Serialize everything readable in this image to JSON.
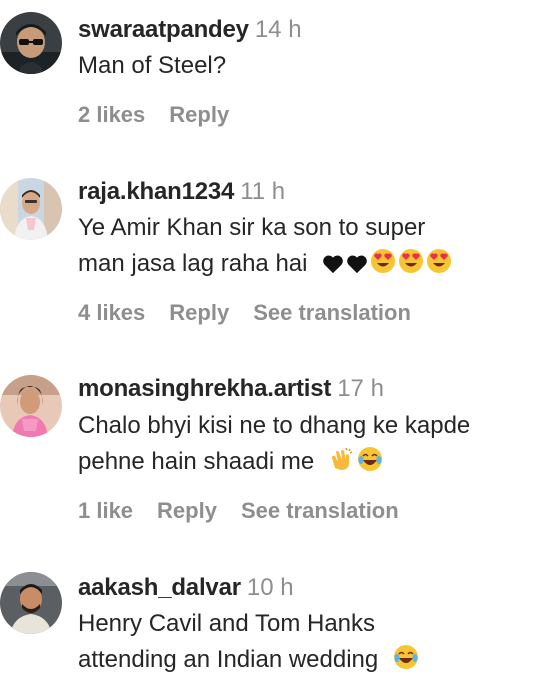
{
  "comments": [
    {
      "username": "swaraatpandey",
      "time": "14 h",
      "lines": [
        "Man of Steel?"
      ],
      "likes": "2 likes",
      "reply": "Reply",
      "translation": ""
    },
    {
      "username": "raja.khan1234",
      "time": "11 h",
      "lines": [
        "Ye Amir Khan sir ka son to super",
        "man jasa lag raha hai"
      ],
      "emoji": [
        "black-heart",
        "black-heart",
        "heart-eyes",
        "heart-eyes",
        "heart-eyes"
      ],
      "likes": "4 likes",
      "reply": "Reply",
      "translation": "See translation"
    },
    {
      "username": "monasinghrekha.artist",
      "time": "17 h",
      "lines": [
        "Chalo bhyi kisi ne to dhang ke kapde",
        "pehne hain shaadi me"
      ],
      "emoji": [
        "clapping-hands",
        "tears-of-joy"
      ],
      "likes": "1 like",
      "reply": "Reply",
      "translation": "See translation"
    },
    {
      "username": "aakash_dalvar",
      "time": "10 h",
      "lines": [
        "Henry Cavil and Tom Hanks",
        "attending an Indian wedding"
      ],
      "emoji": [
        "tears-of-joy"
      ],
      "likes": "",
      "reply": "",
      "translation": ""
    }
  ]
}
